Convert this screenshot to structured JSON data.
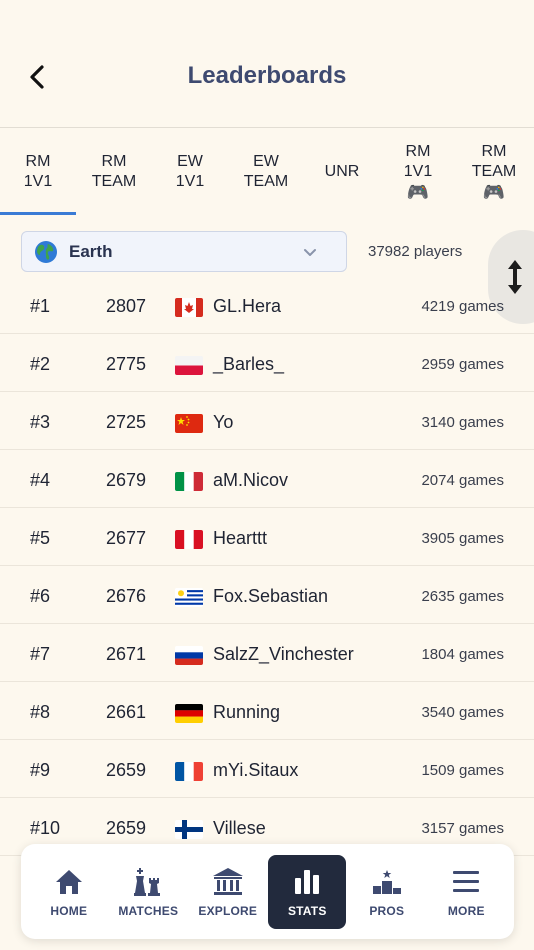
{
  "header": {
    "title": "Leaderboards",
    "back_icon": "chevron-left-icon"
  },
  "tabs": [
    {
      "line1": "RM",
      "line2": "1V1",
      "active": true,
      "controller": false
    },
    {
      "line1": "RM",
      "line2": "TEAM",
      "active": false,
      "controller": false
    },
    {
      "line1": "EW",
      "line2": "1V1",
      "active": false,
      "controller": false
    },
    {
      "line1": "EW",
      "line2": "TEAM",
      "active": false,
      "controller": false
    },
    {
      "line1": "UNR",
      "line2": "",
      "active": false,
      "controller": false
    },
    {
      "line1": "RM",
      "line2": "1V1",
      "active": false,
      "controller": true,
      "icon": "🎮"
    },
    {
      "line1": "RM",
      "line2": "TEAM",
      "active": false,
      "controller": true,
      "icon": "🎮"
    }
  ],
  "filter": {
    "region": "Earth",
    "region_icon": "globe-icon",
    "player_count": "37982 players",
    "sort_icon": "sort-vertical-icon"
  },
  "leaderboard": [
    {
      "rank": "#1",
      "rating": "2807",
      "flag": "CA",
      "name": "GL.Hera",
      "games": "4219 games"
    },
    {
      "rank": "#2",
      "rating": "2775",
      "flag": "PL",
      "name": "_Barles_",
      "games": "2959 games"
    },
    {
      "rank": "#3",
      "rating": "2725",
      "flag": "CN",
      "name": "Yo",
      "games": "3140 games"
    },
    {
      "rank": "#4",
      "rating": "2679",
      "flag": "IT",
      "name": "aM.Nicov",
      "games": "2074 games"
    },
    {
      "rank": "#5",
      "rating": "2677",
      "flag": "PE",
      "name": "Hearttt",
      "games": "3905 games"
    },
    {
      "rank": "#6",
      "rating": "2676",
      "flag": "UY",
      "name": "Fox.Sebastian",
      "games": "2635 games"
    },
    {
      "rank": "#7",
      "rating": "2671",
      "flag": "RU",
      "name": "SalzZ_Vinchester",
      "games": "1804 games"
    },
    {
      "rank": "#8",
      "rating": "2661",
      "flag": "DE",
      "name": "Running",
      "games": "3540 games"
    },
    {
      "rank": "#9",
      "rating": "2659",
      "flag": "FR",
      "name": "mYi.Sitaux",
      "games": "1509 games"
    },
    {
      "rank": "#10",
      "rating": "2659",
      "flag": "FI",
      "name": "Villese",
      "games": "3157 games"
    }
  ],
  "bottom_nav": [
    {
      "label": "HOME",
      "icon": "home-icon",
      "active": false
    },
    {
      "label": "MATCHES",
      "icon": "chess-pieces-icon",
      "active": false
    },
    {
      "label": "EXPLORE",
      "icon": "museum-icon",
      "active": false
    },
    {
      "label": "STATS",
      "icon": "bar-chart-icon",
      "active": true
    },
    {
      "label": "PROS",
      "icon": "podium-icon",
      "active": false
    },
    {
      "label": "MORE",
      "icon": "menu-icon",
      "active": false
    }
  ],
  "colors": {
    "background": "#fdf8ee",
    "title": "#3e4a70",
    "active_tab": "#3a7bd5",
    "nav_active": "#222a3d"
  }
}
